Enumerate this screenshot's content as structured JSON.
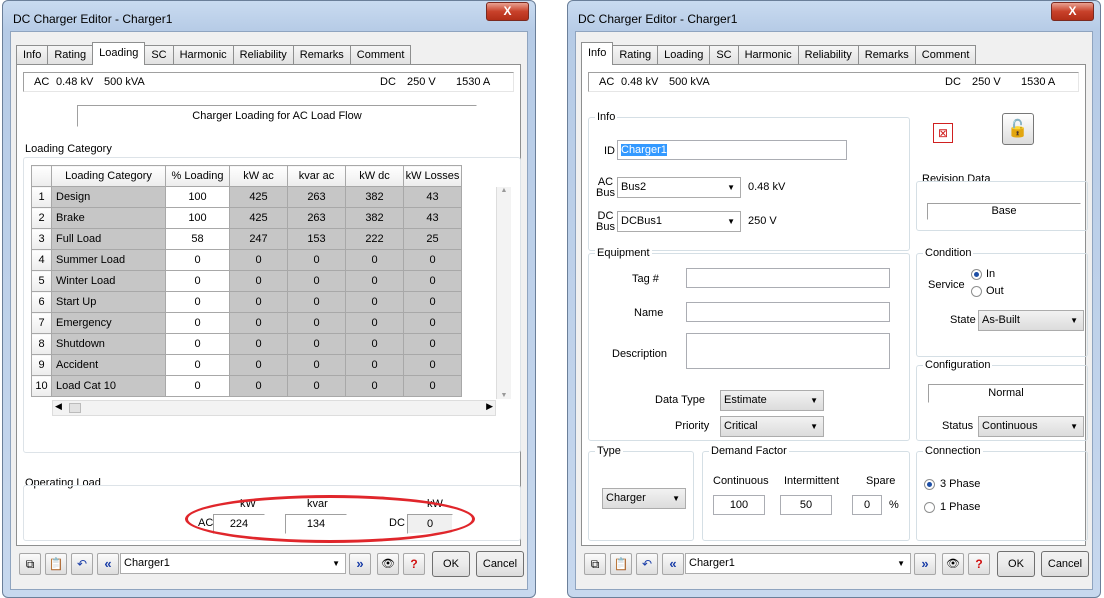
{
  "left": {
    "title": "DC Charger Editor - Charger1",
    "close": "X",
    "tabs": [
      "Info",
      "Rating",
      "Loading",
      "SC",
      "Harmonic",
      "Reliability",
      "Remarks",
      "Comment"
    ],
    "active_tab": "Loading",
    "header": {
      "ac": "AC",
      "ac_kv": "0.48 kV",
      "ac_kva": "500 kVA",
      "dc": "DC",
      "dc_v": "250 V",
      "dc_a": "1530 A"
    },
    "loading_banner": "Charger Loading for AC Load Flow",
    "loading_category_group": "Loading Category",
    "columns": [
      "Loading Category",
      "% Loading",
      "kW ac",
      "kvar ac",
      "kW dc",
      "kW Losses"
    ],
    "rows": [
      {
        "n": "1",
        "cat": "Design",
        "pct": "100",
        "kwac": "425",
        "kvarac": "263",
        "kwdc": "382",
        "loss": "43"
      },
      {
        "n": "2",
        "cat": "Brake",
        "pct": "100",
        "kwac": "425",
        "kvarac": "263",
        "kwdc": "382",
        "loss": "43"
      },
      {
        "n": "3",
        "cat": "Full Load",
        "pct": "58",
        "kwac": "247",
        "kvarac": "153",
        "kwdc": "222",
        "loss": "25"
      },
      {
        "n": "4",
        "cat": "Summer Load",
        "pct": "0",
        "kwac": "0",
        "kvarac": "0",
        "kwdc": "0",
        "loss": "0"
      },
      {
        "n": "5",
        "cat": "Winter Load",
        "pct": "0",
        "kwac": "0",
        "kvarac": "0",
        "kwdc": "0",
        "loss": "0"
      },
      {
        "n": "6",
        "cat": "Start Up",
        "pct": "0",
        "kwac": "0",
        "kvarac": "0",
        "kwdc": "0",
        "loss": "0"
      },
      {
        "n": "7",
        "cat": "Emergency",
        "pct": "0",
        "kwac": "0",
        "kvarac": "0",
        "kwdc": "0",
        "loss": "0"
      },
      {
        "n": "8",
        "cat": "Shutdown",
        "pct": "0",
        "kwac": "0",
        "kvarac": "0",
        "kwdc": "0",
        "loss": "0"
      },
      {
        "n": "9",
        "cat": "Accident",
        "pct": "0",
        "kwac": "0",
        "kvarac": "0",
        "kwdc": "0",
        "loss": "0"
      },
      {
        "n": "10",
        "cat": "Load Cat 10",
        "pct": "0",
        "kwac": "0",
        "kvarac": "0",
        "kwdc": "0",
        "loss": "0"
      }
    ],
    "operating_load": {
      "group": "Operating Load",
      "kw_label": "kW",
      "kvar_label": "kvar",
      "dc_kw_label": "kW",
      "ac": "AC",
      "ac_kw": "224",
      "ac_kvar": "134",
      "dc": "DC",
      "dc_kw": "0"
    },
    "footer": {
      "selector": "Charger1",
      "ok": "OK",
      "cancel": "Cancel"
    }
  },
  "right": {
    "title": "DC Charger Editor - Charger1",
    "close": "X",
    "tabs": [
      "Info",
      "Rating",
      "Loading",
      "SC",
      "Harmonic",
      "Reliability",
      "Remarks",
      "Comment"
    ],
    "active_tab": "Info",
    "header": {
      "ac": "AC",
      "ac_kv": "0.48 kV",
      "ac_kva": "500 kVA",
      "dc": "DC",
      "dc_v": "250 V",
      "dc_a": "1530 A"
    },
    "info": {
      "group": "Info",
      "id_label": "ID",
      "id_value": "Charger1",
      "ac_bus_label1": "AC",
      "ac_bus_label2": "Bus",
      "ac_bus": "Bus2",
      "ac_kv": "0.48 kV",
      "dc_bus_label1": "DC",
      "dc_bus_label2": "Bus",
      "dc_bus": "DCBus1",
      "dc_v": "250 V"
    },
    "revision": {
      "group": "Revision Data",
      "value": "Base"
    },
    "equipment": {
      "group": "Equipment",
      "tag_label": "Tag #",
      "tag": "",
      "name_label": "Name",
      "name": "",
      "desc_label": "Description",
      "desc": "",
      "datatype_label": "Data Type",
      "datatype": "Estimate",
      "priority_label": "Priority",
      "priority": "Critical"
    },
    "condition": {
      "group": "Condition",
      "service_label": "Service",
      "in": "In",
      "out": "Out",
      "state_label": "State",
      "state": "As-Built"
    },
    "configuration": {
      "group": "Configuration",
      "value": "Normal",
      "status_label": "Status",
      "status": "Continuous"
    },
    "type": {
      "group": "Type",
      "value": "Charger"
    },
    "demand": {
      "group": "Demand Factor",
      "cont_label": "Continuous",
      "int_label": "Intermittent",
      "spare_label": "Spare",
      "cont": "100",
      "int": "50",
      "spare": "0",
      "pct": "%"
    },
    "connection": {
      "group": "Connection",
      "three": "3 Phase",
      "one": "1 Phase"
    },
    "footer": {
      "selector": "Charger1",
      "ok": "OK",
      "cancel": "Cancel"
    }
  }
}
